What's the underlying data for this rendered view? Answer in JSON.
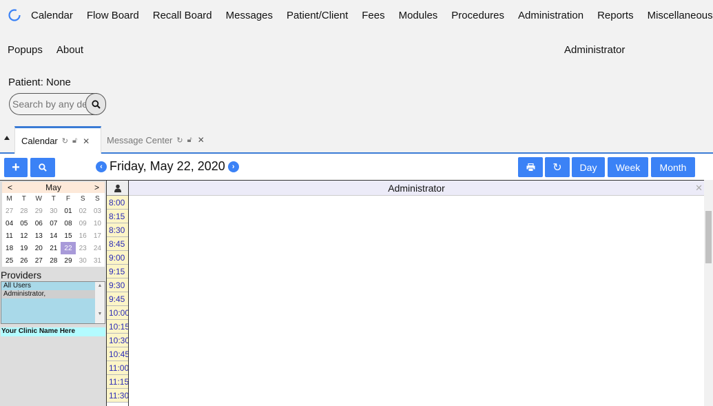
{
  "nav": {
    "row1": [
      "Calendar",
      "Flow Board",
      "Recall Board",
      "Messages",
      "Patient/Client",
      "Fees",
      "Modules",
      "Procedures",
      "Administration",
      "Reports",
      "Miscellaneous"
    ],
    "row2": [
      "Popups",
      "About"
    ],
    "user": "Administrator"
  },
  "patient": {
    "label": "Patient: None"
  },
  "search": {
    "placeholder": "Search by any demographics"
  },
  "tabs": [
    {
      "label": "Calendar"
    },
    {
      "label": "Message Center"
    }
  ],
  "toolbar": {
    "date": "Friday, May 22, 2020",
    "day_label": "Day",
    "week_label": "Week",
    "month_label": "Month"
  },
  "minical": {
    "month": "May",
    "prev": "<",
    "next": ">",
    "weekdays": [
      "M",
      "T",
      "W",
      "T",
      "F",
      "S",
      "S"
    ],
    "weeks": [
      [
        "27",
        "28",
        "29",
        "30",
        "01",
        "02",
        "03"
      ],
      [
        "04",
        "05",
        "06",
        "07",
        "08",
        "09",
        "10"
      ],
      [
        "11",
        "12",
        "13",
        "14",
        "15",
        "16",
        "17"
      ],
      [
        "18",
        "19",
        "20",
        "21",
        "22",
        "23",
        "24"
      ],
      [
        "25",
        "26",
        "27",
        "28",
        "29",
        "30",
        "31"
      ]
    ],
    "selected": "22"
  },
  "providers": {
    "title": "Providers",
    "items": [
      "All Users",
      "Administrator,"
    ]
  },
  "clinic": "Your Clinic Name Here",
  "schedule": {
    "provider": "Administrator",
    "times": [
      "8:00",
      "8:15",
      "8:30",
      "8:45",
      "9:00",
      "9:15",
      "9:30",
      "9:45",
      "10:00",
      "10:15",
      "10:30",
      "10:45",
      "11:00",
      "11:15",
      "11:30"
    ]
  },
  "colors": {
    "accent": "#3b82f6",
    "selected_day": "#a89ad9",
    "time_slot": "#fcf5c7"
  }
}
